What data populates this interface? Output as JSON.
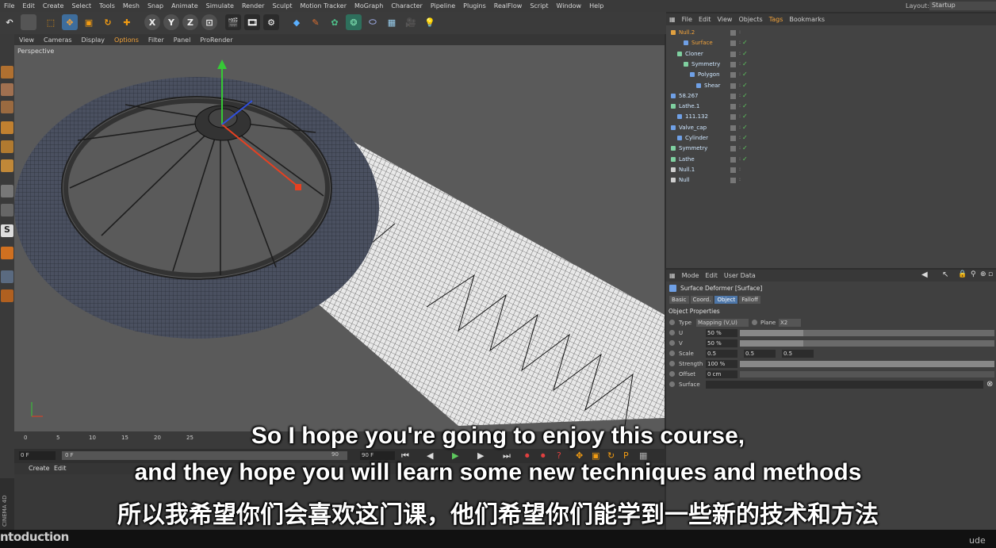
{
  "menubar": {
    "items": [
      "File",
      "Edit",
      "Create",
      "Select",
      "Tools",
      "Mesh",
      "Snap",
      "Animate",
      "Simulate",
      "Render",
      "Sculpt",
      "Motion Tracker",
      "MoGraph",
      "Character",
      "Pipeline",
      "Plugins",
      "RealFlow",
      "Script",
      "Window",
      "Help"
    ],
    "layout_label": "Layout:",
    "layout_value": "Startup"
  },
  "toolbar": {
    "x": "X",
    "y": "Y",
    "z": "Z"
  },
  "viewport": {
    "menu": [
      "View",
      "Cameras",
      "Display",
      "Options",
      "Filter",
      "Panel",
      "ProRender"
    ],
    "highlighted": "Options",
    "label": "Perspective"
  },
  "timeline": {
    "ticks": [
      "0",
      "5",
      "10",
      "15",
      "20",
      "25"
    ],
    "start_frame": "0 F",
    "current_frame": "0 F",
    "end_frame": "90 F",
    "end_tick": "90"
  },
  "bottom": {
    "tab_create": "Create",
    "tab_edit": "Edit",
    "brand": "CINEMA 4D"
  },
  "objects": {
    "menu": [
      "File",
      "Edit",
      "View",
      "Objects",
      "Tags",
      "Bookmarks"
    ],
    "highlighted": "Tags",
    "rows": [
      {
        "name": "Null.2",
        "indent": 0,
        "color": "#e0a040",
        "icon": "null-icon"
      },
      {
        "name": "Surface",
        "indent": 2,
        "color": "#6fa0e6",
        "icon": "surface-deformer-icon"
      },
      {
        "name": "Cloner",
        "indent": 1,
        "color": "#7fd0a0",
        "icon": "cloner-icon"
      },
      {
        "name": "Symmetry",
        "indent": 2,
        "color": "#7fd0a0",
        "icon": "symmetry-icon"
      },
      {
        "name": "Polygon",
        "indent": 3,
        "color": "#6fa0e6",
        "icon": "polygon-icon"
      },
      {
        "name": "Shear",
        "indent": 4,
        "color": "#6fa0e6",
        "icon": "shear-icon"
      },
      {
        "name": "58.267",
        "indent": 0,
        "color": "#6fa0e6",
        "icon": "spline-icon"
      },
      {
        "name": "Lathe.1",
        "indent": 0,
        "color": "#7fd0a0",
        "icon": "lathe-icon"
      },
      {
        "name": "111.132",
        "indent": 1,
        "color": "#6fa0e6",
        "icon": "spline-icon"
      },
      {
        "name": "Valve_cap",
        "indent": 0,
        "color": "#6fa0e6",
        "icon": "polygon-icon"
      },
      {
        "name": "Cylinder",
        "indent": 1,
        "color": "#6fa0e6",
        "icon": "cylinder-icon"
      },
      {
        "name": "Symmetry",
        "indent": 0,
        "color": "#7fd0a0",
        "icon": "symmetry-icon"
      },
      {
        "name": "Lathe",
        "indent": 0,
        "color": "#7fd0a0",
        "icon": "lathe-icon"
      },
      {
        "name": "Null.1",
        "indent": 0,
        "color": "#cfcfcf",
        "icon": "null-icon"
      },
      {
        "name": "Null",
        "indent": 0,
        "color": "#cfcfcf",
        "icon": "null-icon"
      }
    ]
  },
  "attributes": {
    "menu": [
      "Mode",
      "Edit",
      "User Data"
    ],
    "title": "Surface Deformer [Surface]",
    "tabs": [
      "Basic",
      "Coord.",
      "Object",
      "Falloff"
    ],
    "selected_tab": "Object",
    "section": "Object Properties",
    "type_label": "Type",
    "type_value": "Mapping (V,U)",
    "plane_label": "Plane",
    "plane_value": "X2",
    "u_label": "U",
    "u_value": "50 %",
    "u_fraction": 0.5,
    "v_label": "V",
    "v_value": "50 %",
    "v_fraction": 0.5,
    "scale_label": "Scale",
    "scale_x": "0.5",
    "scale_y": "0.5",
    "scale_z": "0.5",
    "strength_label": "Strength",
    "strength_value": "100 %",
    "strength_fraction": 1.0,
    "offset_label": "Offset",
    "offset_value": "0 cm",
    "surface_label": "Surface"
  },
  "subtitles": {
    "line1": "So I hope you're going to enjoy this course,",
    "line2": "and they hope you will learn some new techniques and methods",
    "line3": "所以我希望你们会喜欢这门课，他们希望你们能学到一些新的技术和方法"
  },
  "status": {
    "intro": "ntoduction",
    "watermark": "ude"
  }
}
